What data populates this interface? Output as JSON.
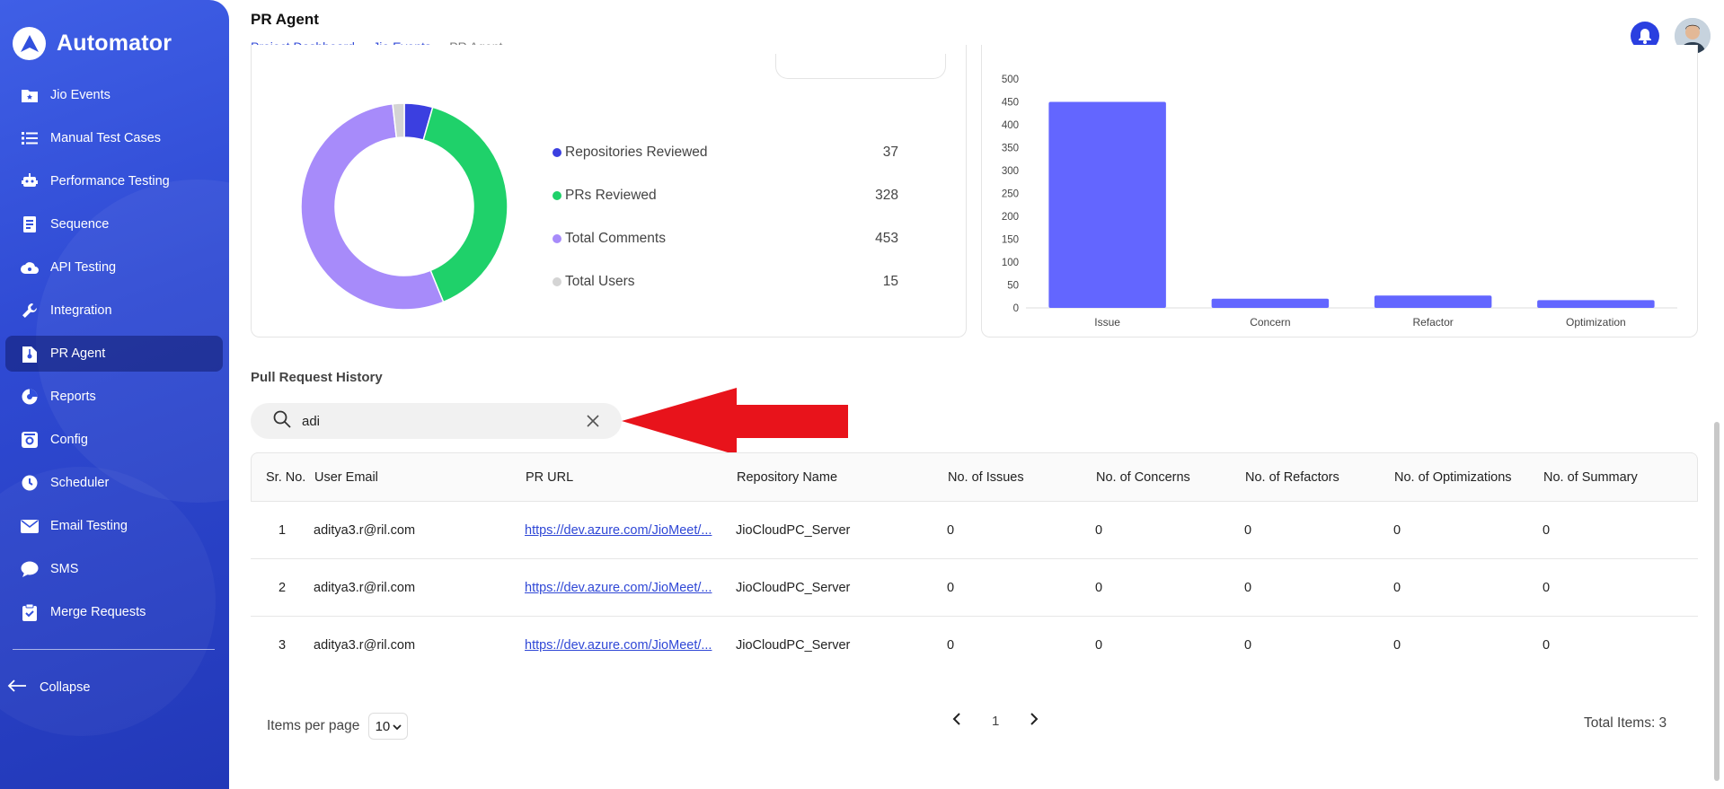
{
  "app": {
    "name": "Automator"
  },
  "sidebar": {
    "items": [
      {
        "label": "Jio Events",
        "icon": "folder-star-icon"
      },
      {
        "label": "Manual Test Cases",
        "icon": "list-icon"
      },
      {
        "label": "Performance Testing",
        "icon": "robot-icon"
      },
      {
        "label": "Sequence",
        "icon": "document-icon"
      },
      {
        "label": "API Testing",
        "icon": "cloud-icon"
      },
      {
        "label": "Integration",
        "icon": "wrench-icon"
      },
      {
        "label": "PR Agent",
        "icon": "file-git-icon",
        "active": true
      },
      {
        "label": "Reports",
        "icon": "pie-icon"
      },
      {
        "label": "Config",
        "icon": "settings-box-icon"
      },
      {
        "label": "Scheduler",
        "icon": "clock-icon"
      },
      {
        "label": "Email Testing",
        "icon": "mail-icon"
      },
      {
        "label": "SMS",
        "icon": "chat-icon"
      },
      {
        "label": "Merge Requests",
        "icon": "clipboard-icon"
      }
    ],
    "collapse_label": "Collapse"
  },
  "header": {
    "title": "PR Agent",
    "breadcrumb": [
      "Project Dashboard",
      "Jio Events",
      "PR Agent"
    ]
  },
  "summary": {
    "items": [
      {
        "label": "Repositories Reviewed",
        "value": 37,
        "color": "#3b3fe0"
      },
      {
        "label": "PRs Reviewed",
        "value": 328,
        "color": "#1fd16a"
      },
      {
        "label": "Total Comments",
        "value": 453,
        "color": "#a78bfa"
      },
      {
        "label": "Total Users",
        "value": 15,
        "color": "#d4d4d4"
      }
    ]
  },
  "chart_data": {
    "type": "bar",
    "categories": [
      "Issue",
      "Concern",
      "Refactor",
      "Optimization"
    ],
    "values": [
      450,
      20,
      27,
      17
    ],
    "ylim": [
      0,
      500
    ],
    "yticks": [
      0,
      50,
      100,
      150,
      200,
      250,
      300,
      350,
      400,
      450,
      500
    ],
    "color": "#6366ff",
    "grid": false
  },
  "history": {
    "title": "Pull Request History",
    "search_value": "adi",
    "columns": [
      "Sr. No.",
      "User Email",
      "PR URL",
      "Repository Name",
      "No. of Issues",
      "No. of Concerns",
      "No. of Refactors",
      "No. of Optimizations",
      "No. of Summary"
    ],
    "rows": [
      {
        "sr": "1",
        "email": "aditya3.r@ril.com",
        "url": "https://dev.azure.com/JioMeet/...",
        "repo": "JioCloudPC_Server",
        "issues": "0",
        "concerns": "0",
        "refactors": "0",
        "optimizations": "0",
        "summary": "0"
      },
      {
        "sr": "2",
        "email": "aditya3.r@ril.com",
        "url": "https://dev.azure.com/JioMeet/...",
        "repo": "JioCloudPC_Server",
        "issues": "0",
        "concerns": "0",
        "refactors": "0",
        "optimizations": "0",
        "summary": "0"
      },
      {
        "sr": "3",
        "email": "aditya3.r@ril.com",
        "url": "https://dev.azure.com/JioMeet/...",
        "repo": "JioCloudPC_Server",
        "issues": "0",
        "concerns": "0",
        "refactors": "0",
        "optimizations": "0",
        "summary": "0"
      }
    ]
  },
  "pagination": {
    "items_per_page_label": "Items per page",
    "items_per_page": "10",
    "current_page": "1",
    "total_label": "Total Items: 3"
  }
}
